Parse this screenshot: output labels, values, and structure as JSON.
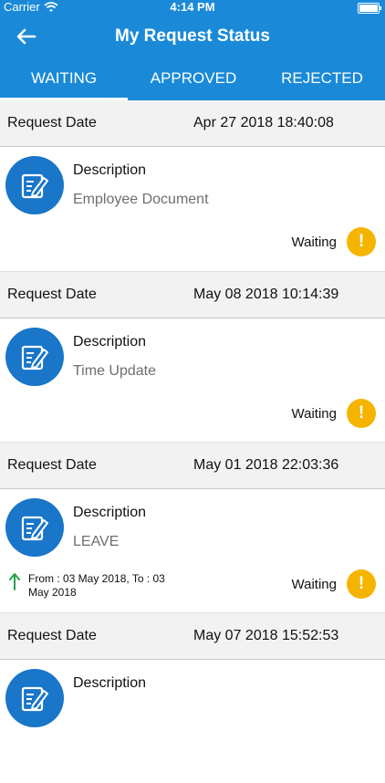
{
  "status_bar": {
    "carrier": "Carrier",
    "time": "4:14 PM"
  },
  "nav": {
    "title": "My Request Status"
  },
  "tabs": [
    {
      "label": "WAITING",
      "active": true
    },
    {
      "label": "APPROVED",
      "active": false
    },
    {
      "label": "REJECTED",
      "active": false
    }
  ],
  "requests": [
    {
      "date_label": "Request Date",
      "date": "Apr 27 2018 18:40:08",
      "desc_label": "Description",
      "desc": "Employee Document",
      "status": "Waiting"
    },
    {
      "date_label": "Request Date",
      "date": "May 08 2018 10:14:39",
      "desc_label": "Description",
      "desc": "Time Update",
      "status": "Waiting"
    },
    {
      "date_label": "Request Date",
      "date": "May 01 2018 22:03:36",
      "desc_label": "Description",
      "desc": "LEAVE",
      "status": "Waiting",
      "range": "From : 03 May 2018, To : 03 May 2018"
    },
    {
      "date_label": "Request Date",
      "date": "May 07 2018 15:52:53",
      "desc_label": "Description",
      "desc": "",
      "status": ""
    }
  ],
  "icons": {
    "back": "back-arrow-icon",
    "avatar": "edit-document-icon",
    "status": "exclamation-icon",
    "range": "arrow-up-icon"
  },
  "colors": {
    "primary": "#1a8ad8",
    "avatar": "#1976c9",
    "warning": "#f5b400",
    "range_arrow": "#22a34a"
  },
  "warning_glyph": "!"
}
